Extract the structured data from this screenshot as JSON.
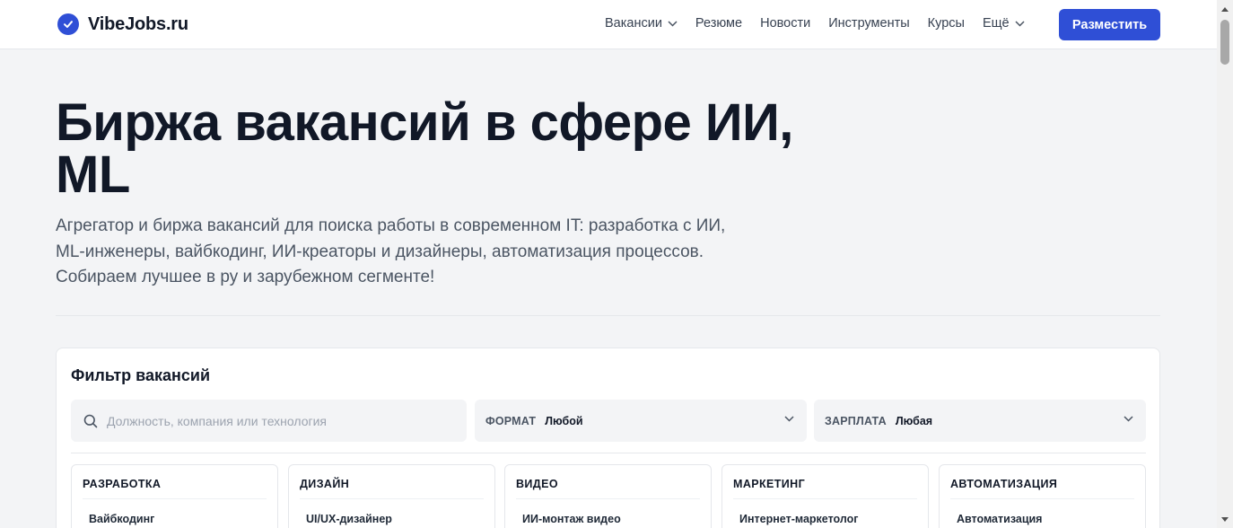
{
  "header": {
    "logo_text": "VibeJobs.ru",
    "nav": [
      {
        "label": "Вакансии",
        "has_dropdown": true
      },
      {
        "label": "Резюме",
        "has_dropdown": false
      },
      {
        "label": "Новости",
        "has_dropdown": false
      },
      {
        "label": "Инструменты",
        "has_dropdown": false
      },
      {
        "label": "Курсы",
        "has_dropdown": false
      },
      {
        "label": "Ещё",
        "has_dropdown": true
      }
    ],
    "cta_label": "Разместить"
  },
  "hero": {
    "title": "Биржа вакансий в сфере ИИ, ML",
    "subtitle": "Агрегатор и биржа вакансий для поиска работы в современном IT: разработка с ИИ, ML-инженеры, вайбкодинг, ИИ-креаторы и дизайнеры, автоматизация процессов. Собираем лучшее в ру и зарубежном сегменте!"
  },
  "filter": {
    "title": "Фильтр вакансий",
    "search_placeholder": "Должность, компания или технология",
    "search_value": "",
    "format": {
      "label": "ФОРМАТ",
      "value": "Любой"
    },
    "salary": {
      "label": "ЗАРПЛАТА",
      "value": "Любая"
    },
    "categories": [
      {
        "title": "РАЗРАБОТКА",
        "first_item": "Вайбкодинг"
      },
      {
        "title": "ДИЗАЙН",
        "first_item": "UI/UX-дизайнер"
      },
      {
        "title": "ВИДЕО",
        "first_item": "ИИ-монтаж видео"
      },
      {
        "title": "МАРКЕТИНГ",
        "first_item": "Интернет-маркетолог"
      },
      {
        "title": "АВТОМАТИЗАЦИЯ",
        "first_item": "Автоматизация"
      }
    ]
  },
  "colors": {
    "accent": "#2f4fd6",
    "page_bg": "#f3f4f6",
    "card_bg": "#ffffff",
    "text_primary": "#111827",
    "text_secondary": "#4b5563"
  },
  "icons": {
    "logo": "check-circle-icon",
    "search": "search-icon",
    "dropdown": "chevron-down-icon"
  }
}
